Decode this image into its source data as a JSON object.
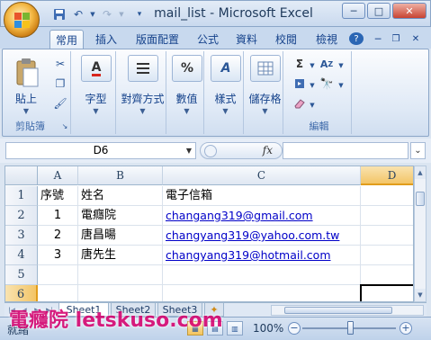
{
  "window": {
    "title": "mail_list - Microsoft Excel"
  },
  "ribbon": {
    "tabs": [
      "常用",
      "插入",
      "版面配置",
      "公式",
      "資料",
      "校閱",
      "檢視"
    ],
    "active_tab": "常用",
    "groups": {
      "clipboard": {
        "paste_label": "貼上",
        "group_label": "剪貼簿"
      },
      "font": {
        "label": "字型"
      },
      "alignment": {
        "label": "對齊方式"
      },
      "number": {
        "label": "數值",
        "icon_text": "%"
      },
      "styles": {
        "label": "樣式"
      },
      "cells": {
        "label": "儲存格"
      },
      "editing": {
        "group_label": "編輯",
        "sum_icon": "Σ"
      }
    }
  },
  "formula_bar": {
    "name_box": "D6",
    "fx_label": "fx",
    "content": ""
  },
  "sheet": {
    "columns": [
      "A",
      "B",
      "C",
      "D"
    ],
    "selected_column": "D",
    "row_numbers": [
      "1",
      "2",
      "3",
      "4",
      "5",
      "6"
    ],
    "selected_row": "6",
    "rows": [
      {
        "a": "序號",
        "b": "姓名",
        "c": "電子信箱"
      },
      {
        "a": "1",
        "b": "電癮院",
        "c": "changang319@gmail.com"
      },
      {
        "a": "2",
        "b": "唐昌暘",
        "c": "changyang319@yahoo.com.tw"
      },
      {
        "a": "3",
        "b": "唐先生",
        "c": "changyang319@hotmail.com"
      },
      {
        "a": "",
        "b": "",
        "c": ""
      },
      {
        "a": "",
        "b": "",
        "c": ""
      }
    ],
    "tabs": [
      "Sheet1",
      "Sheet2",
      "Sheet3"
    ],
    "active_tab": "Sheet1"
  },
  "status_bar": {
    "status": "就緒",
    "zoom": "100%"
  },
  "watermark": {
    "text": "電癮院 letskuso.com"
  },
  "colors": {
    "accent": "#1e395b",
    "link": "#0000c8",
    "selection": "#f3c567",
    "watermark": "#d6006e"
  }
}
